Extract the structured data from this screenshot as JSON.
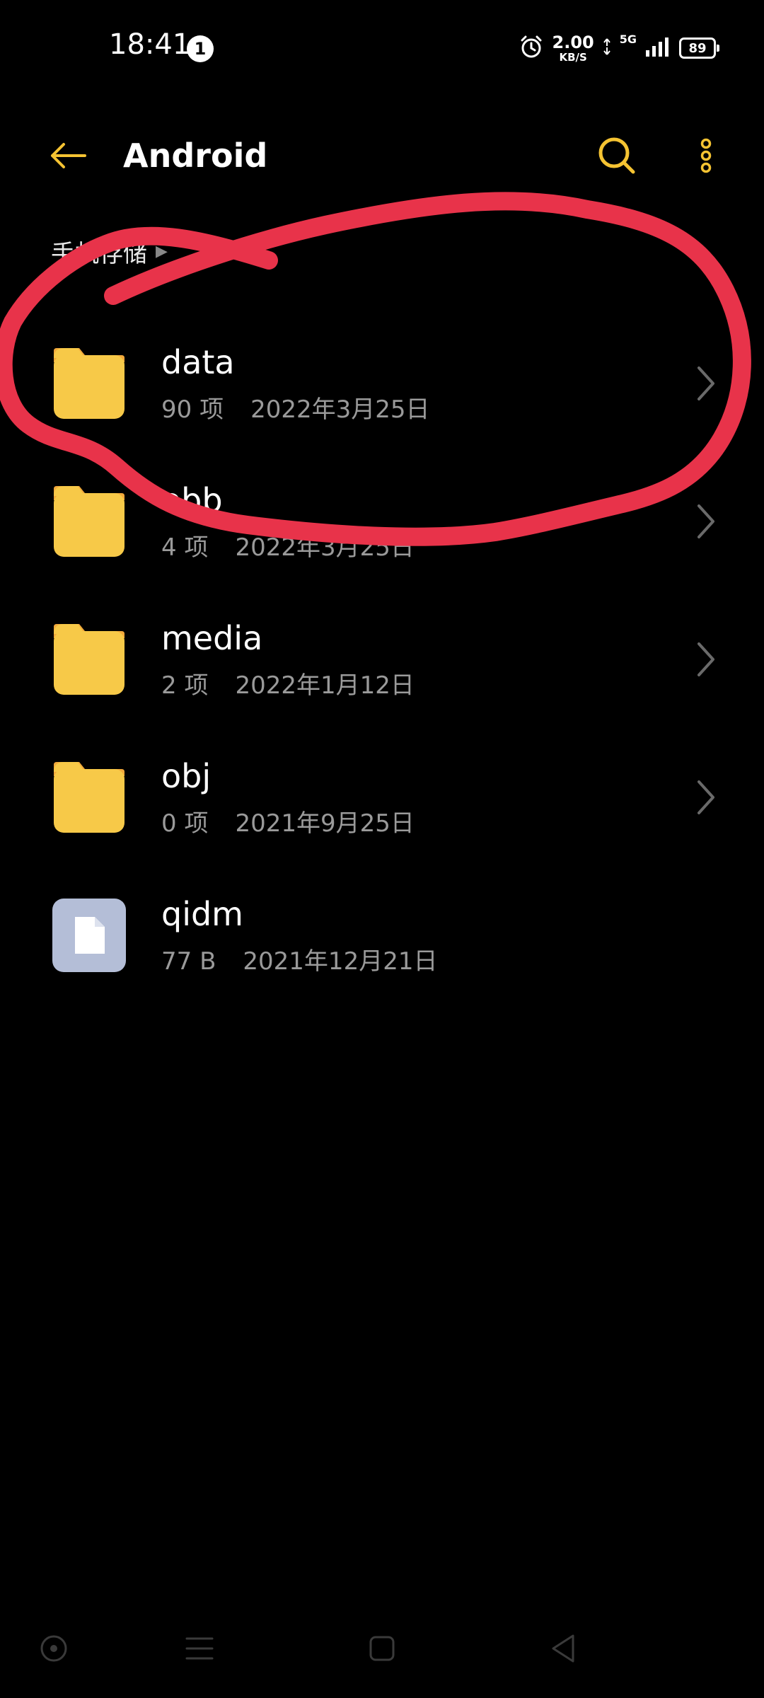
{
  "status_bar": {
    "time": "18:41",
    "notification_count": "1",
    "speed_value": "2.00",
    "speed_unit": "KB/S",
    "network": "5G",
    "battery": "89"
  },
  "app_bar": {
    "title": "Android",
    "icons": [
      "back-arrow-icon",
      "search-icon",
      "more-vertical-icon"
    ],
    "accent_color": "#F5C332"
  },
  "breadcrumb": {
    "items": [
      "手机存储"
    ]
  },
  "files": [
    {
      "name": "data",
      "count": "90 项",
      "date": "2022年3月25日",
      "type": "folder"
    },
    {
      "name": "obb",
      "count": "4 项",
      "date": "2022年3月25日",
      "type": "folder"
    },
    {
      "name": "media",
      "count": "2 项",
      "date": "2022年1月12日",
      "type": "folder"
    },
    {
      "name": "obj",
      "count": "0 项",
      "date": "2021年9月25日",
      "type": "folder"
    },
    {
      "name": "qidm",
      "count": "77 B",
      "date": "2021年12月21日",
      "type": "file"
    }
  ],
  "colors": {
    "folder": "#F7C948",
    "folder_tab": "#F2A93B",
    "file_icon_bg": "#B4BED7",
    "annotation": "#E8334A"
  },
  "nav_bar": {
    "icons": [
      "assistant-dot-icon",
      "menu-lines-icon",
      "home-square-icon",
      "back-triangle-icon"
    ]
  }
}
